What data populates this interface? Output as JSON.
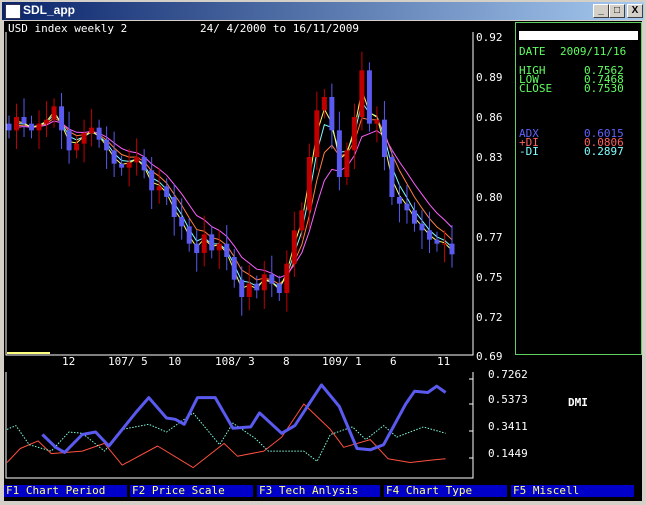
{
  "window": {
    "title": "SDL_app",
    "minimize": "_",
    "maximize": "□",
    "close": "X"
  },
  "header": {
    "instrument": "USD index weekly 2",
    "date_range": "24/ 4/2000 to 16/11/2009"
  },
  "info": {
    "date_label": "DATE",
    "date": "2009/11/16",
    "high_label": "HIGH",
    "high": "0.7562",
    "low_label": "LOW",
    "low": "0.7468",
    "close_label": "CLOSE",
    "close": "0.7530",
    "adx_label": "ADX",
    "adx": "0.6015",
    "pdi_label": "+DI",
    "pdi": "0.0806",
    "mdi_label": "-DI",
    "mdi": "0.2897"
  },
  "colors": {
    "up": "#c00000",
    "down": "#5a5af0",
    "adx": "#5a5af0",
    "pdi": "#ff5040",
    "mdi": "#80ffe0",
    "ma": [
      "#80ffff",
      "#ff8040",
      "#ff60ff",
      "#ffff60"
    ]
  },
  "chart_data": [
    {
      "type": "candlestick",
      "title": "USD index weekly 2",
      "yticks": [
        "0.92",
        "0.89",
        "0.86",
        "0.83",
        "0.80",
        "0.77",
        "0.75",
        "0.72",
        "0.69"
      ],
      "ylim": [
        0.69,
        0.92
      ],
      "xticks": [
        "12",
        "107/ 5",
        "10",
        "108/ 3",
        "8",
        "109/ 1",
        "6",
        "11"
      ],
      "closes": [
        0.85,
        0.86,
        0.855,
        0.85,
        0.855,
        0.858,
        0.868,
        0.85,
        0.835,
        0.84,
        0.848,
        0.852,
        0.843,
        0.835,
        0.825,
        0.822,
        0.826,
        0.83,
        0.82,
        0.805,
        0.808,
        0.8,
        0.785,
        0.778,
        0.765,
        0.758,
        0.772,
        0.76,
        0.765,
        0.755,
        0.738,
        0.725,
        0.735,
        0.73,
        0.742,
        0.735,
        0.728,
        0.75,
        0.775,
        0.79,
        0.83,
        0.865,
        0.875,
        0.85,
        0.815,
        0.835,
        0.86,
        0.895,
        0.855,
        0.858,
        0.83,
        0.8,
        0.795,
        0.79,
        0.78,
        0.775,
        0.768,
        0.765,
        0.765,
        0.757
      ]
    },
    {
      "type": "line",
      "title": "DMI",
      "yticks": [
        "0.7262",
        "0.5373",
        "0.3411",
        "0.1449"
      ],
      "ylim": [
        0.1449,
        0.7262
      ],
      "series": [
        {
          "name": "ADX",
          "t": [
            0.08,
            0.11,
            0.13,
            0.17,
            0.2,
            0.23,
            0.29,
            0.32,
            0.36,
            0.38,
            0.4,
            0.43,
            0.47,
            0.51,
            0.55,
            0.57,
            0.62,
            0.65,
            0.71,
            0.75,
            0.79,
            0.82,
            0.85,
            0.9,
            0.92,
            0.95,
            0.97,
            0.99
          ],
          "values": [
            0.29,
            0.19,
            0.15,
            0.29,
            0.31,
            0.2,
            0.46,
            0.58,
            0.42,
            0.41,
            0.37,
            0.58,
            0.58,
            0.34,
            0.35,
            0.46,
            0.3,
            0.36,
            0.68,
            0.51,
            0.18,
            0.17,
            0.21,
            0.53,
            0.63,
            0.62,
            0.67,
            0.62
          ]
        },
        {
          "name": "+DI",
          "t": [
            0,
            0.03,
            0.07,
            0.1,
            0.17,
            0.22,
            0.26,
            0.34,
            0.42,
            0.49,
            0.52,
            0.58,
            0.62,
            0.67,
            0.73,
            0.76,
            0.82,
            0.86,
            0.91,
            0.96,
            0.99
          ],
          "values": [
            0.07,
            0.18,
            0.24,
            0.14,
            0.16,
            0.22,
            0.05,
            0.2,
            0.03,
            0.22,
            0.12,
            0.16,
            0.27,
            0.53,
            0.33,
            0.19,
            0.25,
            0.1,
            0.07,
            0.09,
            0.1
          ]
        },
        {
          "name": "-DI",
          "t": [
            0,
            0.02,
            0.05,
            0.1,
            0.14,
            0.17,
            0.22,
            0.26,
            0.32,
            0.36,
            0.42,
            0.48,
            0.51,
            0.56,
            0.59,
            0.67,
            0.7,
            0.73,
            0.78,
            0.81,
            0.85,
            0.88,
            0.94,
            0.99
          ],
          "values": [
            0.33,
            0.36,
            0.21,
            0.16,
            0.31,
            0.3,
            0.16,
            0.33,
            0.37,
            0.31,
            0.46,
            0.21,
            0.38,
            0.26,
            0.16,
            0.16,
            0.08,
            0.29,
            0.35,
            0.25,
            0.36,
            0.27,
            0.35,
            0.3
          ]
        }
      ]
    }
  ],
  "dmi_label": "DMI",
  "function_keys": [
    "F1 Chart Period",
    "F2 Price Scale",
    "F3 Tech Anlysis",
    "F4 Chart Type",
    "F5 Miscell"
  ]
}
